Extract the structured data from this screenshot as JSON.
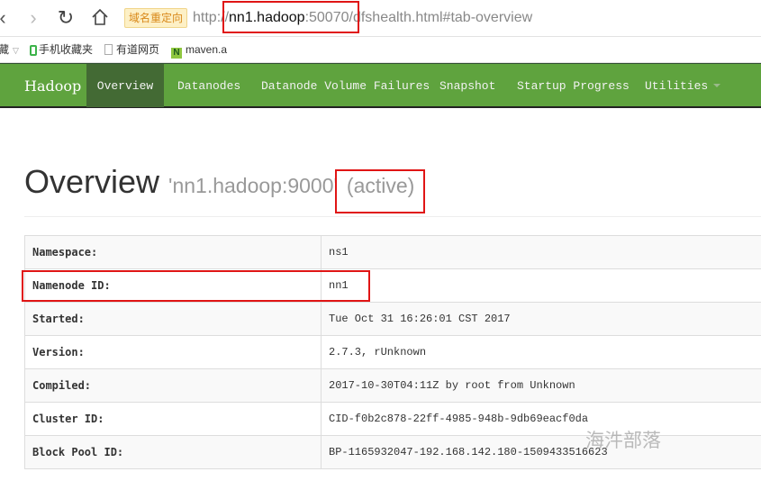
{
  "browser": {
    "nav": {
      "back": "‹",
      "forward": "›",
      "reload": "↻",
      "home": "⌂"
    },
    "redirect_badge": "域名重定向",
    "url": {
      "scheme": "http://",
      "host": "nn1.hadoop",
      "port": ":50070",
      "path": "/dfshealth.html#tab-overview"
    },
    "bookmarks": [
      {
        "label": "藏",
        "icon": "favorites-icon"
      },
      {
        "label": "手机收藏夹",
        "icon": "mobile-icon"
      },
      {
        "label": "有道网页",
        "icon": "page-icon"
      },
      {
        "label": "maven.a",
        "icon": "maven-icon",
        "icon_text": "N"
      }
    ]
  },
  "navbar": {
    "brand": "Hadoop",
    "items": [
      {
        "label": "Overview",
        "active": true
      },
      {
        "label": "Datanodes"
      },
      {
        "label": "Datanode Volume Failures"
      },
      {
        "label": "Snapshot"
      },
      {
        "label": "Startup Progress"
      },
      {
        "label": "Utilities",
        "dropdown": true
      }
    ],
    "colors": {
      "bar": "#5fa33e",
      "active": "#436a34"
    }
  },
  "header": {
    "title": "Overview",
    "host": "'nn1.hadoop:9000'",
    "state": "(active)"
  },
  "overview": {
    "rows": [
      {
        "key": "Namespace:",
        "value": "ns1"
      },
      {
        "key": "Namenode ID:",
        "value": "nn1"
      },
      {
        "key": "Started:",
        "value": "Tue Oct 31 16:26:01 CST 2017"
      },
      {
        "key": "Version:",
        "value": "2.7.3, rUnknown"
      },
      {
        "key": "Compiled:",
        "value": "2017-10-30T04:11Z by root from Unknown"
      },
      {
        "key": "Cluster ID:",
        "value": "CID-f0b2c878-22ff-4985-948b-9db69eacf0da"
      },
      {
        "key": "Block Pool ID:",
        "value": "BP-1165932047-192.168.142.180-1509433516623"
      }
    ]
  },
  "watermark": "海汼部落",
  "annotation_color": "#e01515"
}
